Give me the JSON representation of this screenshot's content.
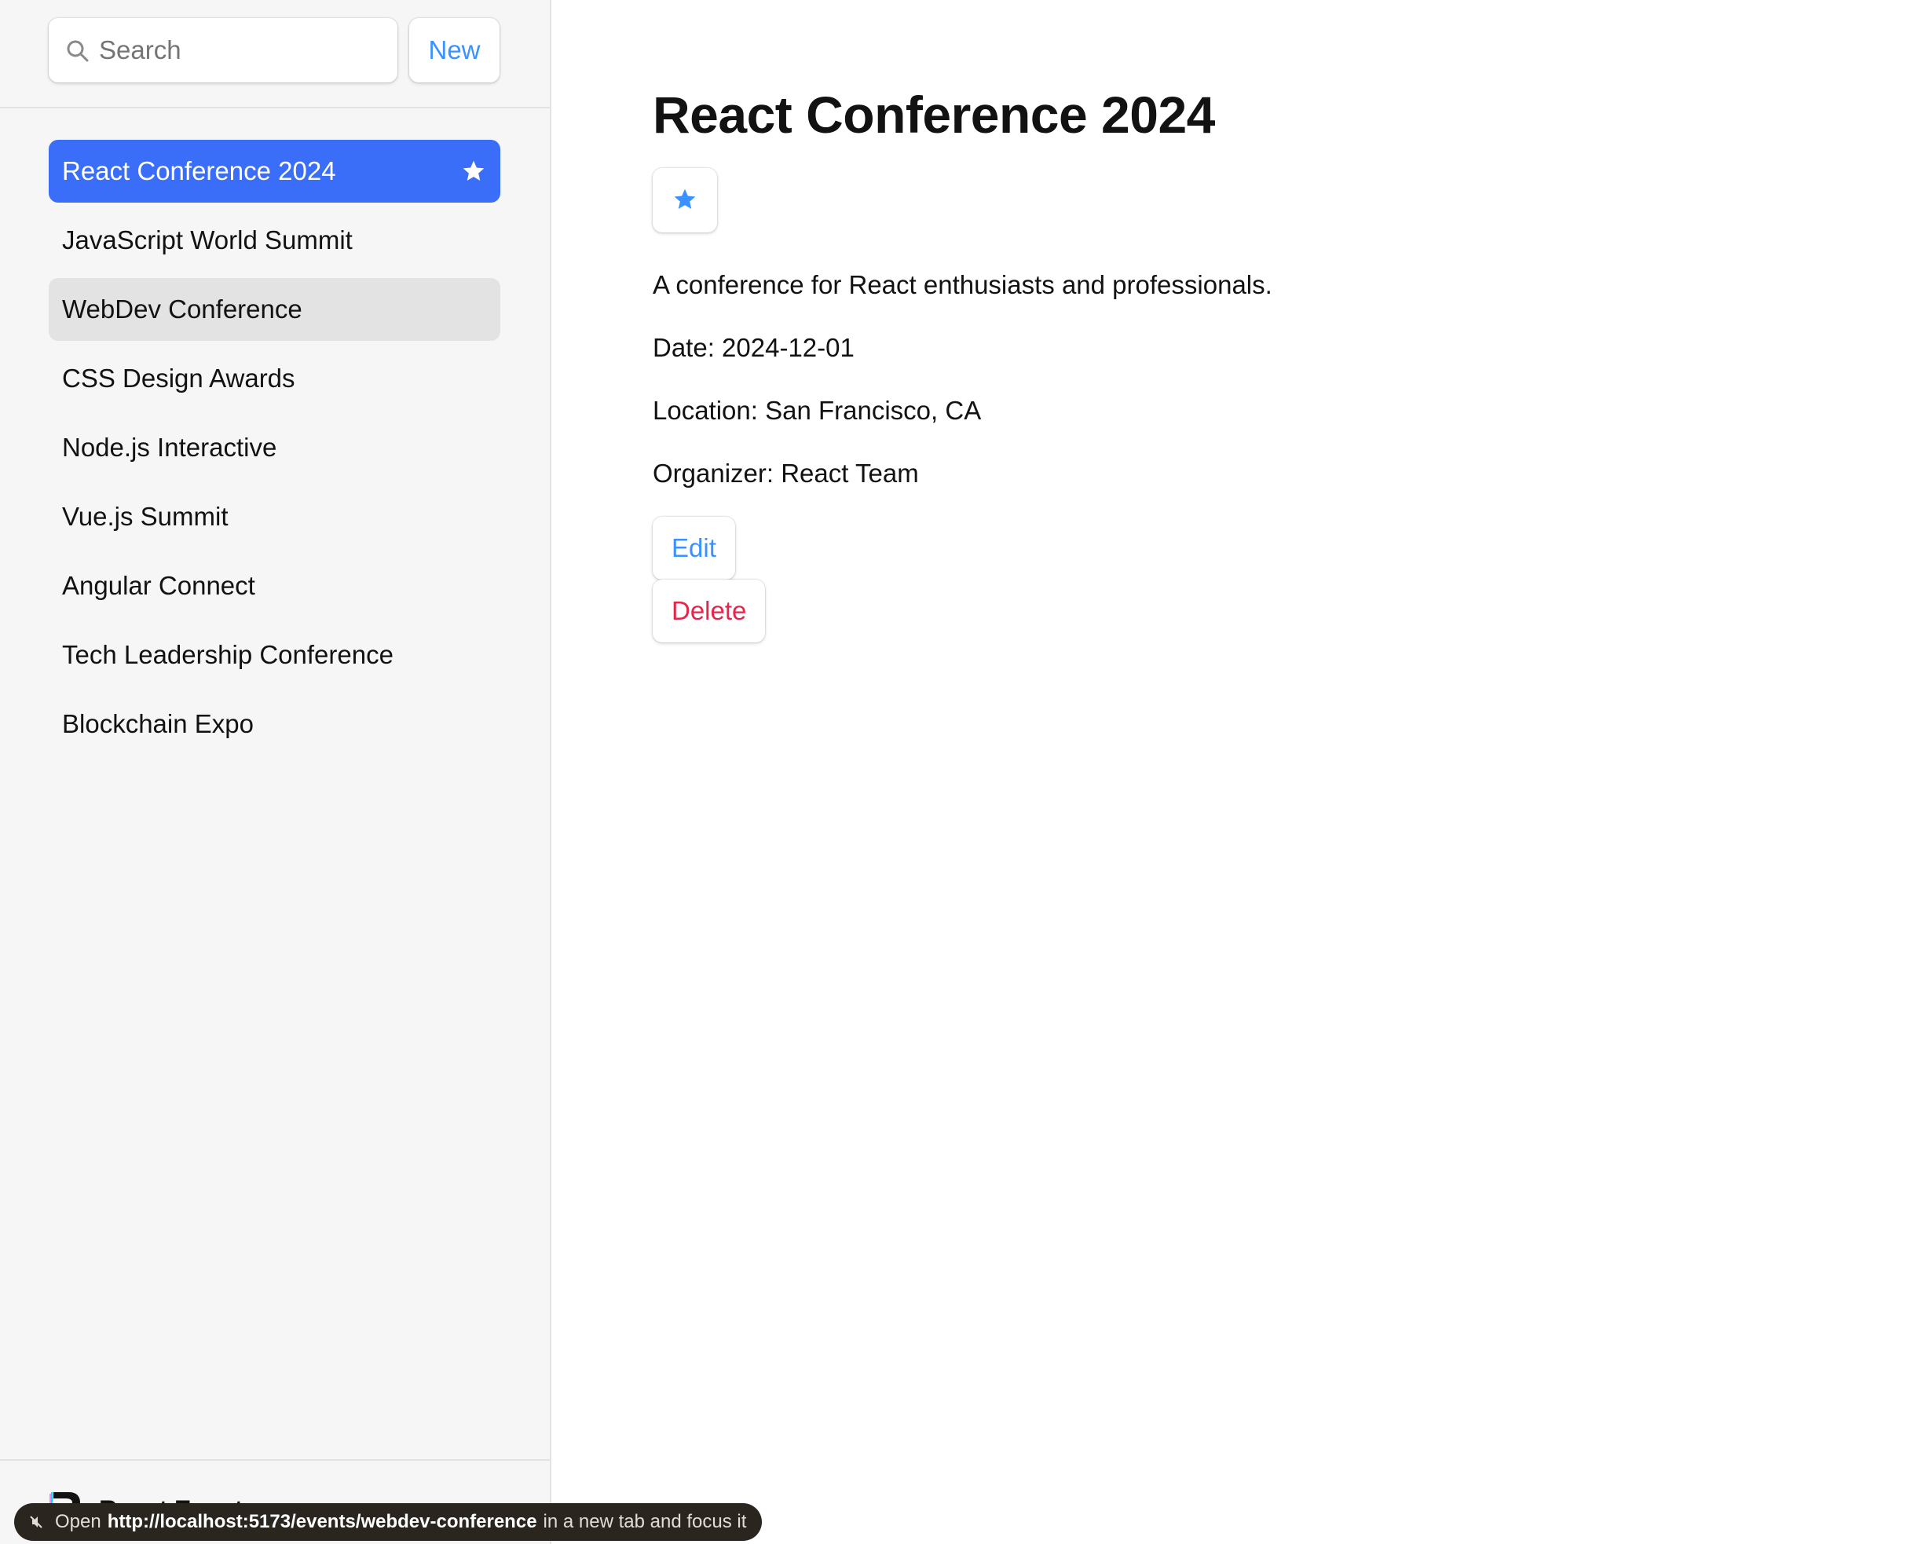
{
  "search": {
    "placeholder": "Search"
  },
  "toolbar": {
    "new_label": "New"
  },
  "sidebar": {
    "items": [
      {
        "label": "React Conference 2024",
        "favorite": true,
        "state": "active"
      },
      {
        "label": "JavaScript World Summit",
        "favorite": false,
        "state": ""
      },
      {
        "label": "WebDev Conference",
        "favorite": false,
        "state": "hover"
      },
      {
        "label": "CSS Design Awards",
        "favorite": false,
        "state": ""
      },
      {
        "label": "Node.js Interactive",
        "favorite": false,
        "state": ""
      },
      {
        "label": "Vue.js Summit",
        "favorite": false,
        "state": ""
      },
      {
        "label": "Angular Connect",
        "favorite": false,
        "state": ""
      },
      {
        "label": "Tech Leadership Conference",
        "favorite": false,
        "state": ""
      },
      {
        "label": "Blockchain Expo",
        "favorite": false,
        "state": ""
      }
    ],
    "footer": {
      "title": "React Events",
      "icon": "remix-logo-icon"
    }
  },
  "event": {
    "title": "React Conference 2024",
    "favorite": true,
    "description": "A conference for React enthusiasts and professionals.",
    "date": "Date: 2024-12-01",
    "location": "Location: San Francisco, CA",
    "organizer": "Organizer: React Team",
    "edit_label": "Edit",
    "delete_label": "Delete"
  },
  "status_tooltip": {
    "prefix": "Open",
    "url": "http://localhost:5173/events/webdev-conference",
    "suffix": "in a new tab and focus it",
    "icon": "mute-icon"
  },
  "colors": {
    "accent": "#3992ff",
    "active_item": "#3a6ef8",
    "danger": "#e3264a",
    "sidebar_bg": "#f6f6f6"
  }
}
